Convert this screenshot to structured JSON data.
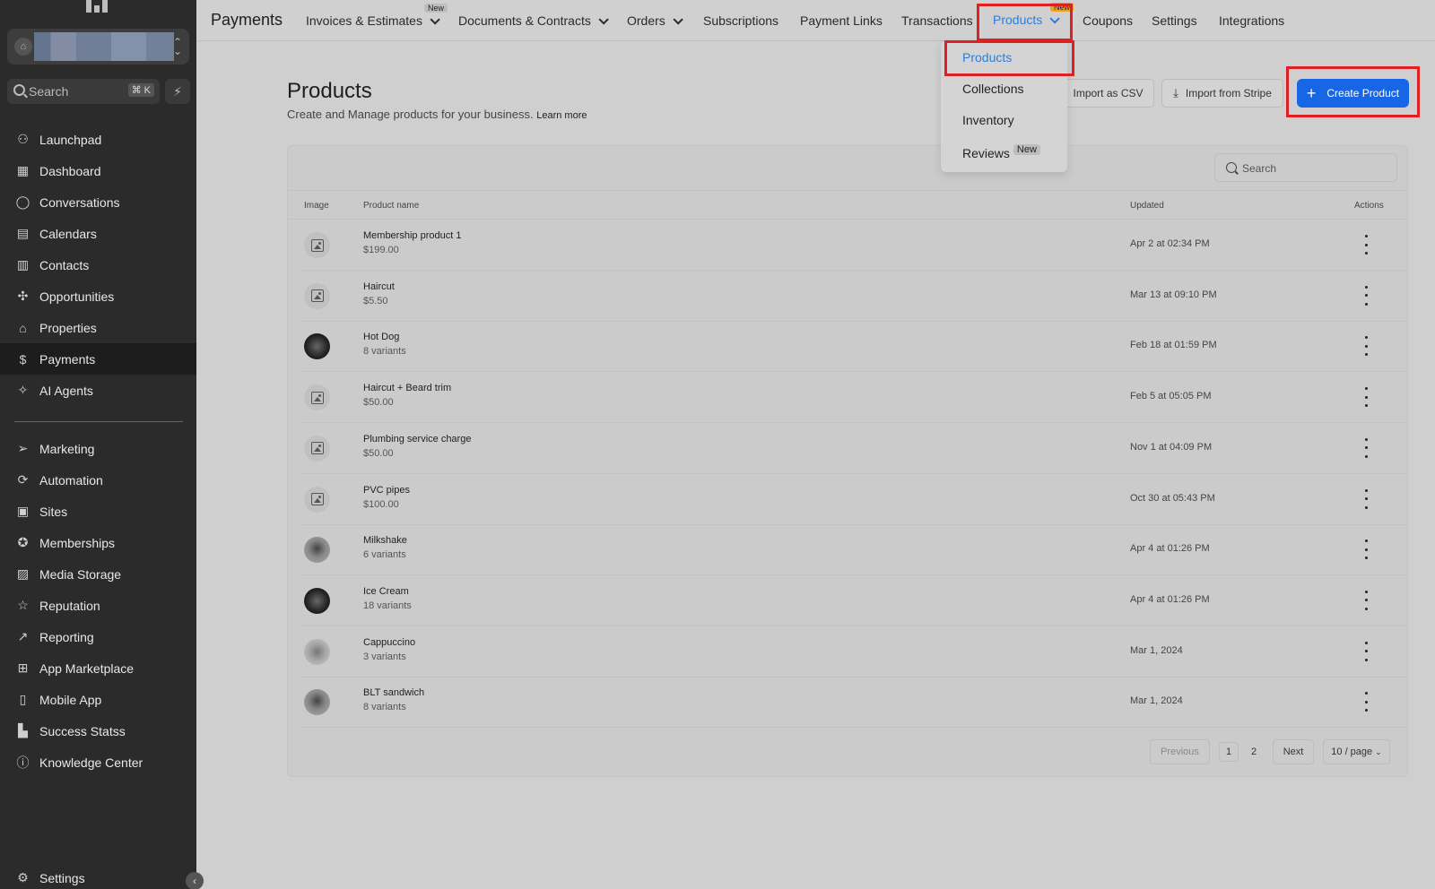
{
  "sidebar": {
    "search_label": "Search",
    "search_shortcut": "⌘ K",
    "items": [
      {
        "label": "Launchpad",
        "icon": "rocket-icon"
      },
      {
        "label": "Dashboard",
        "icon": "grid-icon"
      },
      {
        "label": "Conversations",
        "icon": "chat-icon"
      },
      {
        "label": "Calendars",
        "icon": "calendar-icon"
      },
      {
        "label": "Contacts",
        "icon": "contacts-icon"
      },
      {
        "label": "Opportunities",
        "icon": "funnel-icon"
      },
      {
        "label": "Properties",
        "icon": "home-icon"
      },
      {
        "label": "Payments",
        "icon": "payments-icon"
      },
      {
        "label": "AI Agents",
        "icon": "sparkle-icon"
      },
      {
        "label": "Marketing",
        "icon": "send-icon"
      },
      {
        "label": "Automation",
        "icon": "automation-icon"
      },
      {
        "label": "Sites",
        "icon": "sites-icon"
      },
      {
        "label": "Memberships",
        "icon": "award-icon"
      },
      {
        "label": "Media Storage",
        "icon": "image-icon"
      },
      {
        "label": "Reputation",
        "icon": "star-icon"
      },
      {
        "label": "Reporting",
        "icon": "trend-icon"
      },
      {
        "label": "App Marketplace",
        "icon": "apps-icon"
      },
      {
        "label": "Mobile App",
        "icon": "phone-icon"
      },
      {
        "label": "Success Statss",
        "icon": "stats-icon"
      },
      {
        "label": "Knowledge Center",
        "icon": "info-icon"
      }
    ],
    "settings_label": "Settings"
  },
  "topbar": {
    "title": "Payments",
    "tabs": [
      {
        "label": "Invoices & Estimates",
        "badge": "New"
      },
      {
        "label": "Documents & Contracts"
      },
      {
        "label": "Orders"
      },
      {
        "label": "Subscriptions"
      },
      {
        "label": "Payment Links"
      },
      {
        "label": "Transactions"
      },
      {
        "label": "Products",
        "badge": "New"
      },
      {
        "label": "Coupons"
      },
      {
        "label": "Settings"
      },
      {
        "label": "Integrations"
      }
    ]
  },
  "dropdown": {
    "items": [
      {
        "label": "Products"
      },
      {
        "label": "Collections"
      },
      {
        "label": "Inventory"
      },
      {
        "label": "Reviews",
        "badge": "New"
      }
    ]
  },
  "header": {
    "title": "Products",
    "subtitle": "Create and Manage products for your business.",
    "learn_more": "Learn more",
    "import_csv": "Import as CSV",
    "import_stripe": "Import from Stripe",
    "create_product": "Create Product"
  },
  "table": {
    "search_placeholder": "Search",
    "columns": [
      "Image",
      "Product name",
      "Updated",
      "Actions"
    ],
    "rows": [
      {
        "name": "Membership product 1",
        "sub": "$199.00",
        "updated": "Apr 2 at 02:34 PM",
        "image": "placeholder"
      },
      {
        "name": "Haircut",
        "sub": "$5.50",
        "updated": "Mar 13 at 09:10 PM",
        "image": "placeholder"
      },
      {
        "name": "Hot Dog",
        "sub": "8 variants",
        "updated": "Feb 18 at 01:59 PM",
        "image": "photo"
      },
      {
        "name": "Haircut + Beard trim",
        "sub": "$50.00",
        "updated": "Feb 5 at 05:05 PM",
        "image": "placeholder"
      },
      {
        "name": "Plumbing service charge",
        "sub": "$50.00",
        "updated": "Nov 1 at 04:09 PM",
        "image": "placeholder"
      },
      {
        "name": "PVC pipes",
        "sub": "$100.00",
        "updated": "Oct 30 at 05:43 PM",
        "image": "placeholder"
      },
      {
        "name": "Milkshake",
        "sub": "6 variants",
        "updated": "Apr 4 at 01:26 PM",
        "image": "photo"
      },
      {
        "name": "Ice Cream",
        "sub": "18 variants",
        "updated": "Apr 4 at 01:26 PM",
        "image": "photo"
      },
      {
        "name": "Cappuccino",
        "sub": "3 variants",
        "updated": "Mar 1, 2024",
        "image": "photo"
      },
      {
        "name": "BLT sandwich",
        "sub": "8 variants",
        "updated": "Mar 1, 2024",
        "image": "photo"
      }
    ]
  },
  "pagination": {
    "previous": "Previous",
    "pages": [
      "1",
      "2"
    ],
    "current": "1",
    "next": "Next",
    "page_size": "10 / page"
  },
  "colors": {
    "accent": "#1666e6",
    "highlight": "#e02020",
    "sidebar_bg": "#2b2b2b"
  }
}
